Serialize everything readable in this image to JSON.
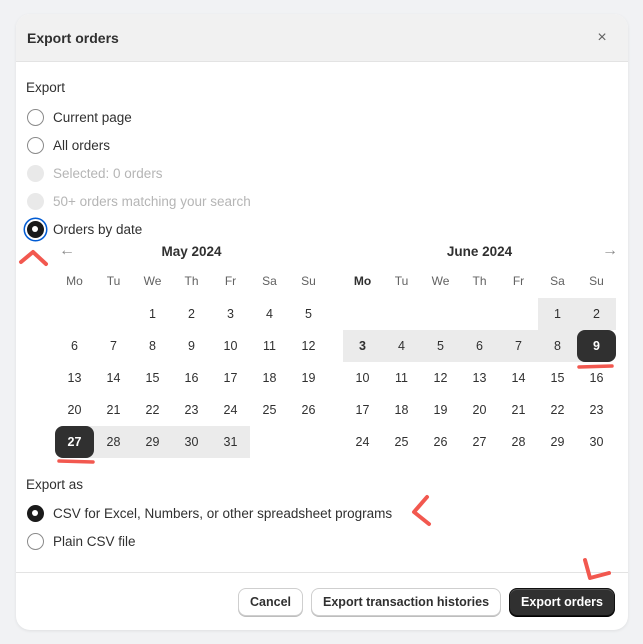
{
  "modal": {
    "title": "Export orders",
    "close_icon": "×"
  },
  "export": {
    "label": "Export",
    "options": [
      {
        "label": "Current page",
        "state": "unchecked"
      },
      {
        "label": "All orders",
        "state": "unchecked"
      },
      {
        "label": "Selected: 0 orders",
        "state": "disabled"
      },
      {
        "label": "50+ orders matching your search",
        "state": "disabled"
      },
      {
        "label": "Orders by date",
        "state": "checked"
      }
    ]
  },
  "calendar": {
    "prev_icon": "←",
    "next_icon": "→",
    "weekdays": [
      "Mo",
      "Tu",
      "We",
      "Th",
      "Fr",
      "Sa",
      "Su"
    ],
    "months": [
      {
        "title": "May 2024",
        "weeks": [
          [
            "",
            "",
            "1",
            "2",
            "3",
            "4",
            "5"
          ],
          [
            "6",
            "7",
            "8",
            "9",
            "10",
            "11",
            "12"
          ],
          [
            "13",
            "14",
            "15",
            "16",
            "17",
            "18",
            "19"
          ],
          [
            "20",
            "21",
            "22",
            "23",
            "24",
            "25",
            "26"
          ],
          [
            "27",
            "28",
            "29",
            "30",
            "31",
            "",
            ""
          ]
        ]
      },
      {
        "title": "June 2024",
        "weeks": [
          [
            "",
            "",
            "",
            "",
            "",
            "1",
            "2"
          ],
          [
            "3",
            "4",
            "5",
            "6",
            "7",
            "8",
            "9"
          ],
          [
            "10",
            "11",
            "12",
            "13",
            "14",
            "15",
            "16"
          ],
          [
            "17",
            "18",
            "19",
            "20",
            "21",
            "22",
            "23"
          ],
          [
            "24",
            "25",
            "26",
            "27",
            "28",
            "29",
            "30"
          ]
        ]
      }
    ],
    "range_start": "May 27, 2024",
    "range_end": "June 9, 2024"
  },
  "export_as": {
    "label": "Export as",
    "options": [
      {
        "label": "CSV for Excel, Numbers, or other spreadsheet programs",
        "state": "checked"
      },
      {
        "label": "Plain CSV file",
        "state": "unchecked"
      }
    ]
  },
  "footer": {
    "cancel_label": "Cancel",
    "histories_label": "Export transaction histories",
    "export_label": "Export orders"
  },
  "colors": {
    "annotation": "#f2584f",
    "primary": "#303030",
    "range": "#ebebeb",
    "focus": "#005bd3"
  }
}
